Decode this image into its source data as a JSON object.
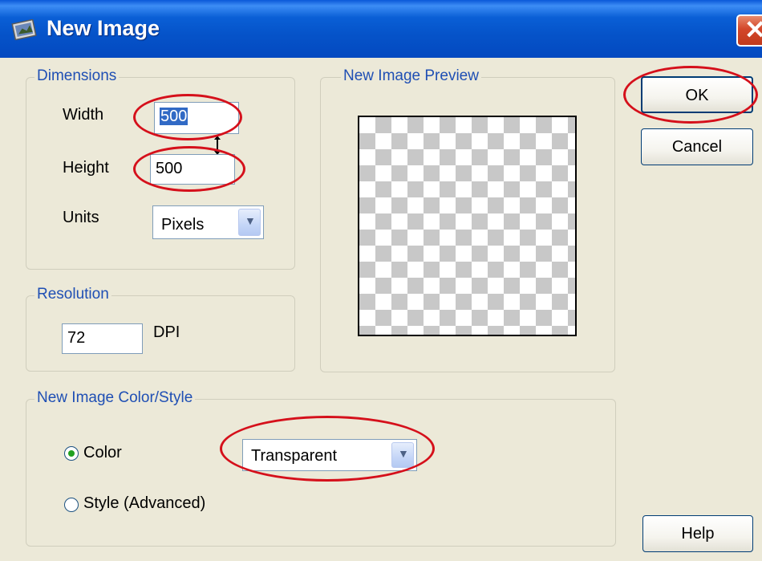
{
  "window": {
    "title": "New Image",
    "title_icon": "paint-shop-icon",
    "close_glyph": "✕"
  },
  "dimensions": {
    "group_label": "Dimensions",
    "width_label": "Width",
    "width_value": "500",
    "height_label": "Height",
    "height_value": "500",
    "units_label": "Units",
    "units_value": "Pixels"
  },
  "resolution": {
    "group_label": "Resolution",
    "value": "72",
    "unit": "DPI"
  },
  "preview": {
    "group_label": "New Image Preview"
  },
  "color_style": {
    "group_label": "New Image Color/Style",
    "color_label": "Color",
    "style_label": "Style (Advanced)",
    "color_value": "Transparent",
    "selected": "Color"
  },
  "buttons": {
    "ok": "OK",
    "cancel": "Cancel",
    "help": "Help"
  },
  "dropdown_icon": "chevron-down-icon",
  "annotation_color": "#d5101b"
}
